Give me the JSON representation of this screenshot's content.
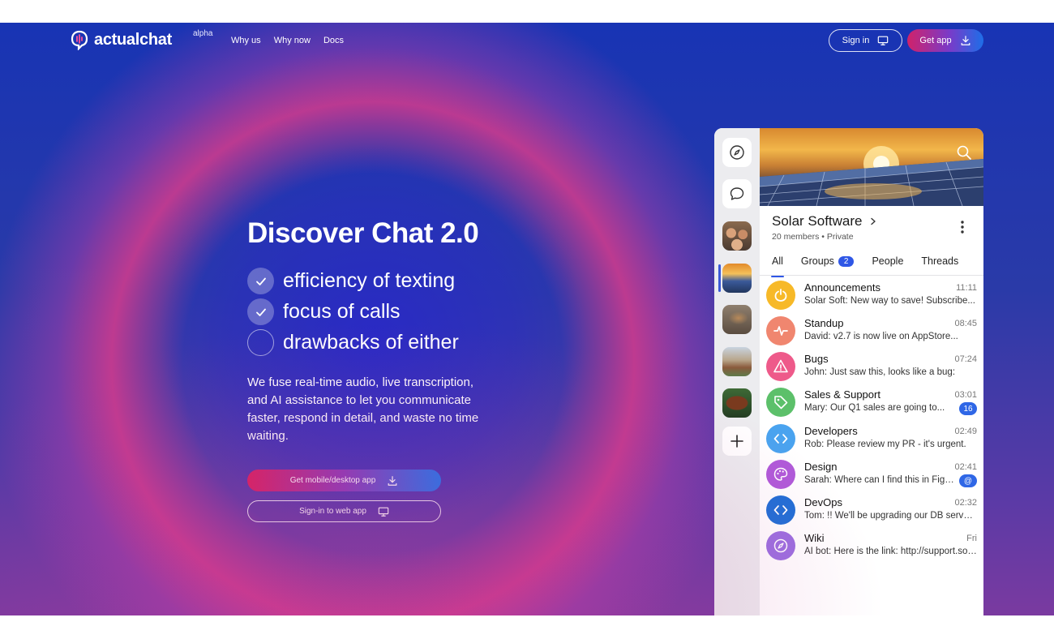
{
  "header": {
    "logo_text": "actualchat",
    "logo_tag": "alpha",
    "nav": [
      "Why us",
      "Why now",
      "Docs"
    ],
    "sign_in_label": "Sign in",
    "get_app_label": "Get app"
  },
  "hero": {
    "title": "Discover Chat 2.0",
    "features": [
      {
        "text": "efficiency of texting",
        "checked": true
      },
      {
        "text": "focus of calls",
        "checked": true
      },
      {
        "text": "drawbacks of either",
        "checked": false
      }
    ],
    "description": "We fuse real-time audio, live transcription, and AI assistance to let you communicate faster, respond in detail, and waste no time waiting.",
    "cta_primary": "Get mobile/desktop app",
    "cta_secondary": "Sign-in to web app"
  },
  "app": {
    "space_name": "Solar Software",
    "space_meta": "20 members • Private",
    "tabs": [
      {
        "label": "All",
        "active": true
      },
      {
        "label": "Groups",
        "count": "2"
      },
      {
        "label": "People"
      },
      {
        "label": "Threads"
      }
    ],
    "chats": [
      {
        "name": "Announcements",
        "time": "11:11",
        "sender": "Solar Soft:",
        "message": "New way to save! Subscribe...",
        "color": "#f7b928",
        "icon": "power-icon"
      },
      {
        "name": "Standup",
        "time": "08:45",
        "sender": "David:",
        "message": "v2.7 is now live on AppStore...",
        "color": "#f0866f",
        "icon": "pulse-icon"
      },
      {
        "name": "Bugs",
        "time": "07:24",
        "sender": "John:",
        "message": "Just saw this, looks like a bug:",
        "color": "#ee5a8a",
        "icon": "warning-icon"
      },
      {
        "name": "Sales & Support",
        "time": "03:01",
        "sender": "Mary:",
        "message": "Our Q1 sales are going to...",
        "color": "#5cc06a",
        "icon": "tag-icon",
        "badge": "16"
      },
      {
        "name": "Developers",
        "time": "02:49",
        "sender": "Rob:",
        "message": "Please review my PR - it's urgent.",
        "color": "#4aa3ef",
        "icon": "code-icon"
      },
      {
        "name": "Design",
        "time": "02:41",
        "sender": "Sarah:",
        "message": "Where can I find this in Figma?",
        "color": "#b05ad9",
        "icon": "palette-icon",
        "badge": "@"
      },
      {
        "name": "DevOps",
        "time": "02:32",
        "sender": "Tom:",
        "message": "!! We'll be upgrading our DB servers...",
        "color": "#1f6fd6",
        "icon": "code-icon"
      },
      {
        "name": "Wiki",
        "time": "Fri",
        "sender": "AI bot:",
        "message": "Here is the link: http://support.solarsoft...",
        "color": "#9b6fe0",
        "icon": "compass-icon"
      }
    ]
  }
}
